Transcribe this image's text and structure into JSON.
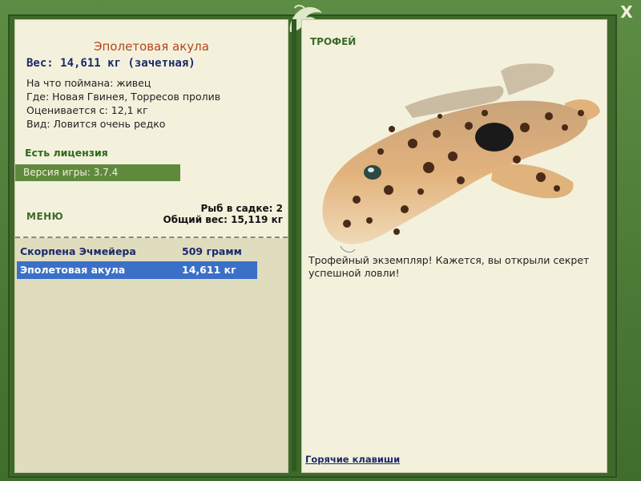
{
  "window": {
    "close_label": "X"
  },
  "fish": {
    "name": "Эполетовая акула",
    "weight_line": "Вес: 14,611 кг (зачетная)",
    "bait": "На что поймана: живец",
    "location": "Где: Новая Гвинея, Торресов пролив",
    "rated_from": "Оценивается с: 12,1 кг",
    "kind": "Вид: Ловится очень редко"
  },
  "license": {
    "label": "Есть лицензия"
  },
  "version": {
    "label": "Версия игры: 3.7.4"
  },
  "menu": {
    "label": "МЕНЮ"
  },
  "net": {
    "count_line": "Рыб в садке: 2",
    "total_line": "Общий вес: 15,119 кг"
  },
  "catch_list": [
    {
      "name": "Скорпена Эчмейера",
      "weight": "509 грамм",
      "selected": false
    },
    {
      "name": "Эполетовая акула",
      "weight": "14,611 кг",
      "selected": true
    }
  ],
  "trophy": {
    "label": "ТРОФЕЙ",
    "message": "Трофейный экземпляр! Кажется, вы открыли секрет успешной ловли!"
  },
  "footer": {
    "hotkeys_label": "Горячие клавиши"
  },
  "colors": {
    "frame_green": "#4a7a34",
    "panel_bg": "#f3f1dc",
    "title_orange": "#b5451a",
    "selection_blue": "#3a70c8"
  }
}
